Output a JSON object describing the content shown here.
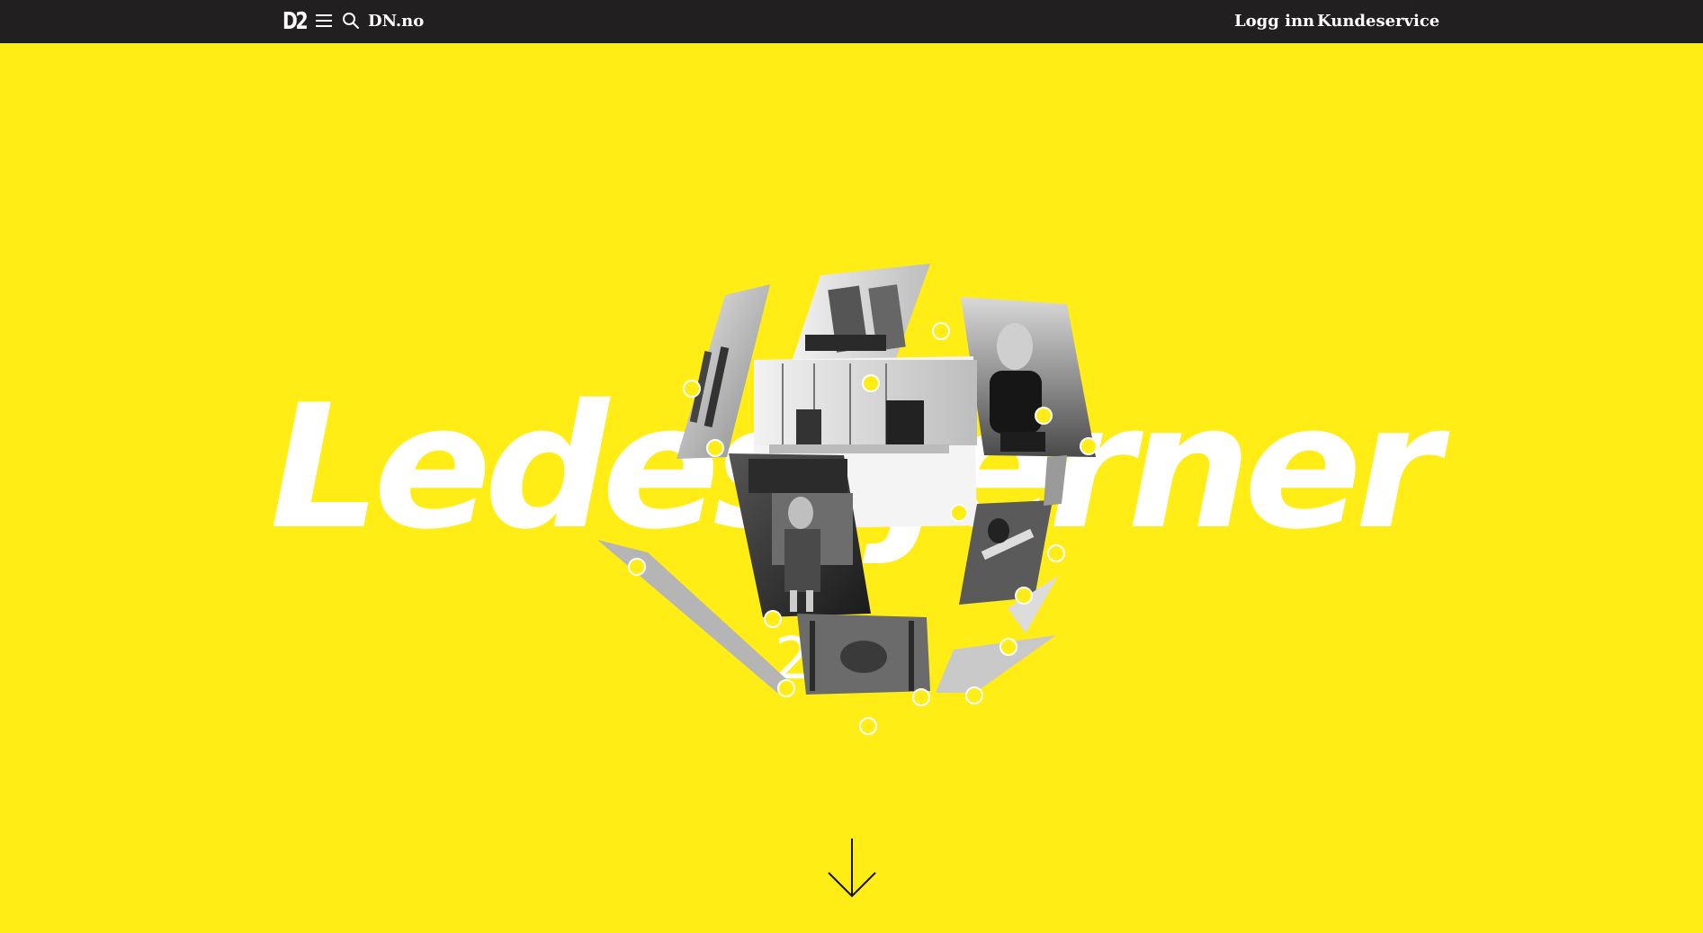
{
  "header": {
    "logo": "D2",
    "menu_icon": "hamburger-menu-icon",
    "search_icon": "search-icon",
    "site_link": "DN.no",
    "login_label": "Logg inn",
    "customer_service_label": "Kundeservice"
  },
  "hero": {
    "title": "Ledestjerner",
    "year": "2022",
    "scroll_icon": "arrow-down-icon"
  },
  "colors": {
    "background": "#FFED15",
    "topbar": "#221F20",
    "text": "#FFFFFF",
    "hotspot": "#FFED15"
  }
}
